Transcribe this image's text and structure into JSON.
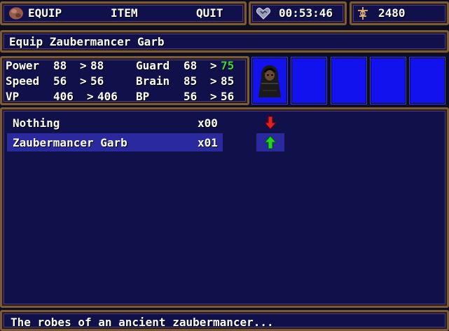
{
  "menu": {
    "equip_label": "EQUIP",
    "item_label": "ITEM",
    "quit_label": "QUIT",
    "equip_icon": "rock-icon"
  },
  "clock": {
    "icon": "heart-icon",
    "time": "00:53:46"
  },
  "gold": {
    "icon": "coin-sparkle-icon",
    "amount": "2480"
  },
  "title": "Equip Zaubermancer Garb",
  "stats": {
    "power": {
      "label": "Power",
      "current": "88",
      "new": "88"
    },
    "speed": {
      "label": "Speed",
      "current": "56",
      "new": "56"
    },
    "vp": {
      "label": "VP",
      "current": "406",
      "new": "406"
    },
    "guard": {
      "label": "Guard",
      "current": "68",
      "new": "75",
      "new_color": "#3cd83c"
    },
    "brain": {
      "label": "Brain",
      "current": "85",
      "new": "85"
    },
    "bp": {
      "label": "BP",
      "current": "56",
      "new": "56"
    },
    "arrow": ">"
  },
  "party": {
    "slots": [
      "hooded-character-portrait",
      "empty",
      "empty",
      "empty",
      "empty"
    ]
  },
  "items": [
    {
      "name": "Nothing",
      "qty": "x00",
      "arrow": "down",
      "arrow_color": "#e02020"
    },
    {
      "name": "Zaubermancer Garb",
      "qty": "x01",
      "arrow": "up",
      "arrow_color": "#20d820",
      "selected": true
    }
  ],
  "description": "The robes of an ancient zaubermancer..."
}
